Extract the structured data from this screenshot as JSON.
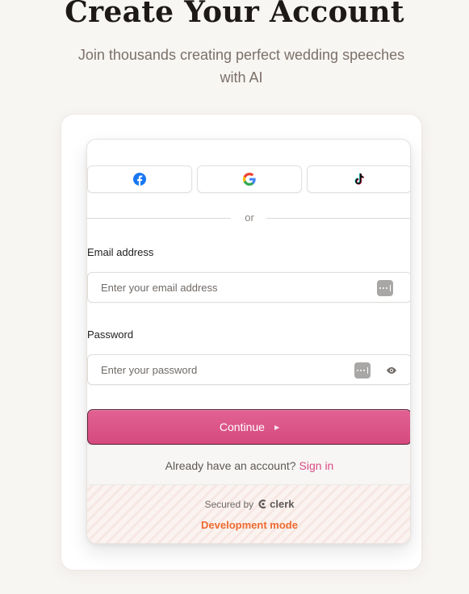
{
  "header": {
    "title": "Create Your Account",
    "subtitle_line1": "Join thousands creating perfect wedding speeches",
    "subtitle_line2": "with AI"
  },
  "social": {
    "providers": [
      "facebook-icon",
      "google-icon",
      "tiktok-icon"
    ]
  },
  "divider": {
    "text": "or"
  },
  "email": {
    "label": "Email address",
    "placeholder": "Enter your email address"
  },
  "password": {
    "label": "Password",
    "placeholder": "Enter your password"
  },
  "continue": {
    "label": "Continue"
  },
  "signin": {
    "prompt": "Already have an account?",
    "link": "Sign in"
  },
  "footer": {
    "secured_by": "Secured by",
    "brand": "clerk",
    "dev_mode": "Development mode"
  },
  "colors": {
    "accent": "#d94a81",
    "dev_mode": "#ee6a2f",
    "background": "#f8f6f3"
  }
}
